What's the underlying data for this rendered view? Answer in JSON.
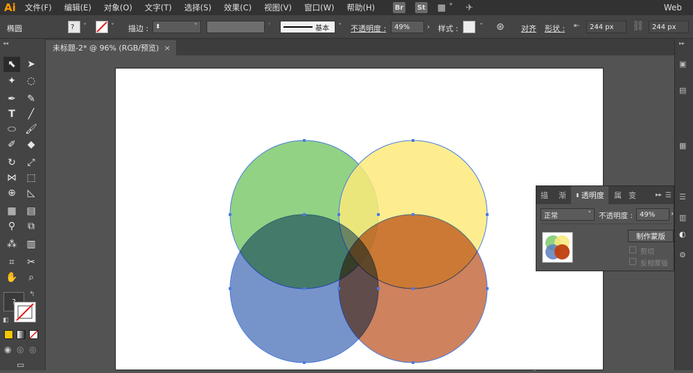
{
  "app": {
    "logo": "Ai",
    "workspace": "Web",
    "br": "Br",
    "st": "St"
  },
  "menu": [
    "文件(F)",
    "编辑(E)",
    "对象(O)",
    "文字(T)",
    "选择(S)",
    "效果(C)",
    "视图(V)",
    "窗口(W)",
    "帮助(H)"
  ],
  "control": {
    "object_type": "椭圆",
    "fill_q": "?",
    "stroke_label": "描边 :",
    "line_style": "基本",
    "opacity_label": "不透明度 :",
    "opacity_value": "49%",
    "style_label": "样式 :",
    "align_label": "对齐",
    "shape_label": "形状 :",
    "width": "244 px",
    "height": "244 px"
  },
  "document_tab": {
    "title": "未标题-2* @ 96% (RGB/预览)",
    "close": "×"
  },
  "toolbox": {
    "fill_question": "?"
  },
  "panel": {
    "tabs": [
      "描",
      "渐",
      "透明度",
      "属",
      "变"
    ],
    "blend_mode": "正常",
    "opacity_label": "不透明度 :",
    "opacity_value": "49%",
    "make_mask": "制作蒙版",
    "clip": "剪切",
    "invert_mask": "反相蒙版"
  },
  "colors": {
    "green": "#7dc96d",
    "yellow": "#fde97a",
    "blue": "#5d7fc0",
    "orange": "#c56a3f",
    "orange_overlap": "#d99148",
    "selection": "#4a7be0"
  },
  "circles": {
    "fill_opacity": 0.84
  }
}
